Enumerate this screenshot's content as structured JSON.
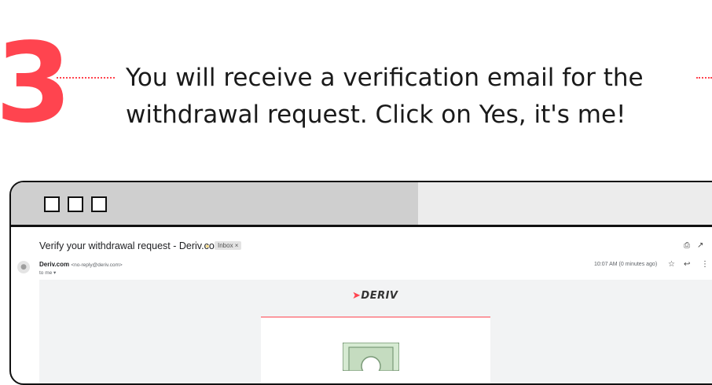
{
  "step": {
    "number": "3",
    "instruction_line1": "You will receive a verification email for the",
    "instruction_line2": "withdrawal request. Click on Yes, it's me!"
  },
  "browser": {
    "window_buttons": [
      "square",
      "square",
      "square"
    ]
  },
  "email": {
    "subject": "Verify your withdrawal request - Deriv.com",
    "label": "Inbox ×",
    "sender_name": "Deriv.com",
    "sender_address": "<no-reply@deriv.com>",
    "recipient": "to me ▾",
    "timestamp": "10:07 AM (0 minutes ago)",
    "icons": [
      "print-icon",
      "open-new-window-icon",
      "star-icon",
      "reply-icon",
      "more-vert-icon",
      "label-arrow-icon",
      "avatar-icon"
    ],
    "body": {
      "logo_text": "DERIV",
      "illustration": "money-note-icon"
    }
  },
  "colors": {
    "accent": "#ff444f",
    "text": "#1a1a1a",
    "chrome": "#cfcfcf",
    "email_bg": "#f2f3f4"
  }
}
